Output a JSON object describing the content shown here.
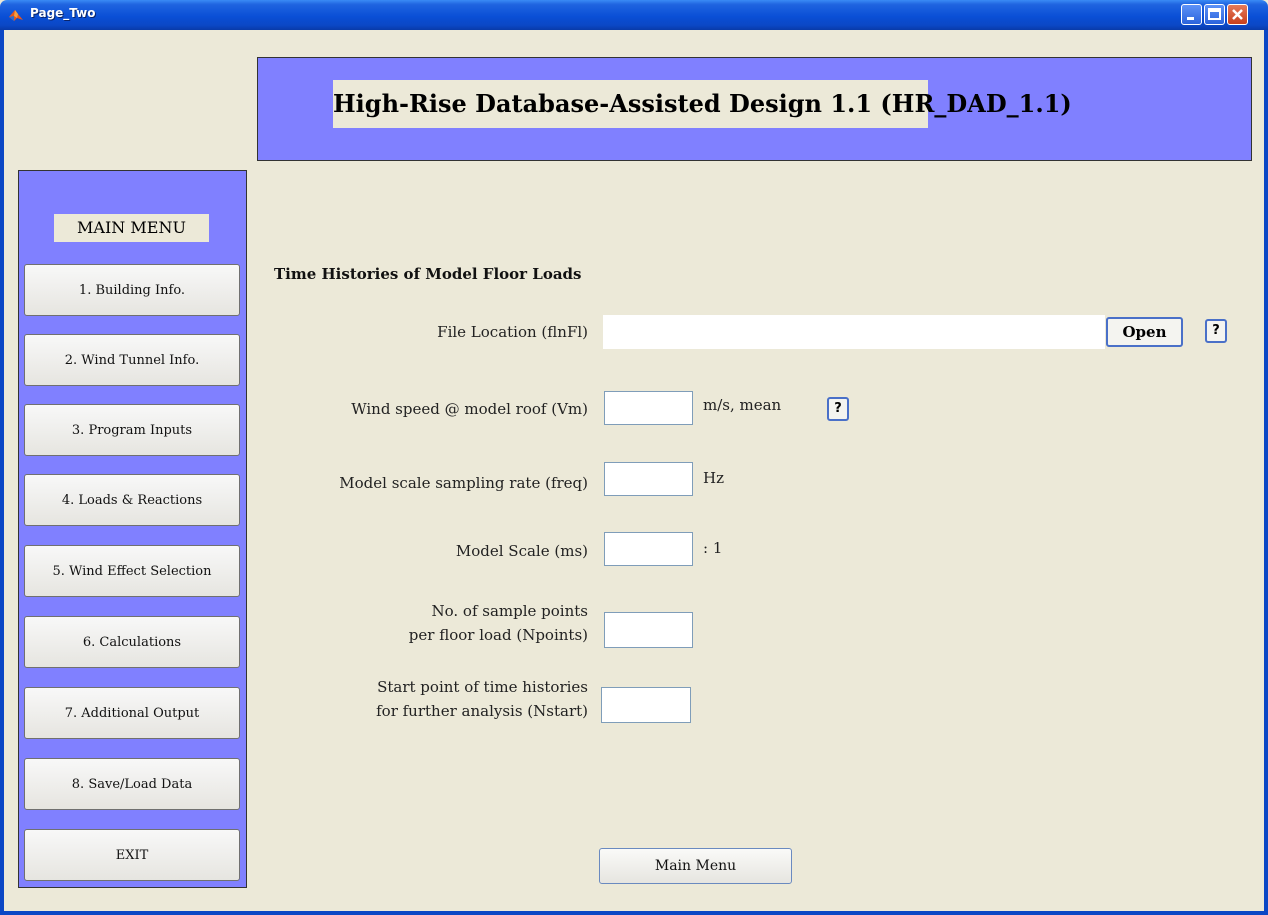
{
  "window": {
    "title": "Page_Two"
  },
  "header": {
    "title": "High-Rise Database-Assisted Design 1.1 (HR_DAD_1.1)"
  },
  "menu": {
    "title": "MAIN MENU",
    "items": [
      "1. Building Info.",
      "2. Wind Tunnel Info.",
      "3. Program Inputs",
      "4. Loads & Reactions",
      "5. Wind Effect Selection",
      "6. Calculations",
      "7.  Additional Output",
      "8. Save/Load Data",
      "EXIT"
    ]
  },
  "form": {
    "section_title": "Time Histories of Model Floor Loads",
    "file_location": {
      "label": "File Location (flnFl)",
      "value": "",
      "open_label": "Open",
      "help_label": "?"
    },
    "wind_speed": {
      "label": "Wind speed @ model roof (Vm)",
      "value": "",
      "unit": "m/s, mean",
      "help_label": "?"
    },
    "sampling_rate": {
      "label": "Model scale sampling rate (freq)",
      "value": "",
      "unit": "Hz"
    },
    "model_scale": {
      "label": "Model Scale (ms)",
      "value": "",
      "unit": ": 1"
    },
    "npoints": {
      "label_line1": "No. of sample points",
      "label_line2": "per floor load (Npoints)",
      "value": ""
    },
    "nstart": {
      "label_line1": "Start point of time histories",
      "label_line2": "for further analysis (Nstart)",
      "value": ""
    }
  },
  "footer": {
    "main_menu_label": "Main Menu"
  },
  "colors": {
    "panel": "#8080ff",
    "background": "#ece9d8",
    "titlebar": "#0b47c5"
  }
}
